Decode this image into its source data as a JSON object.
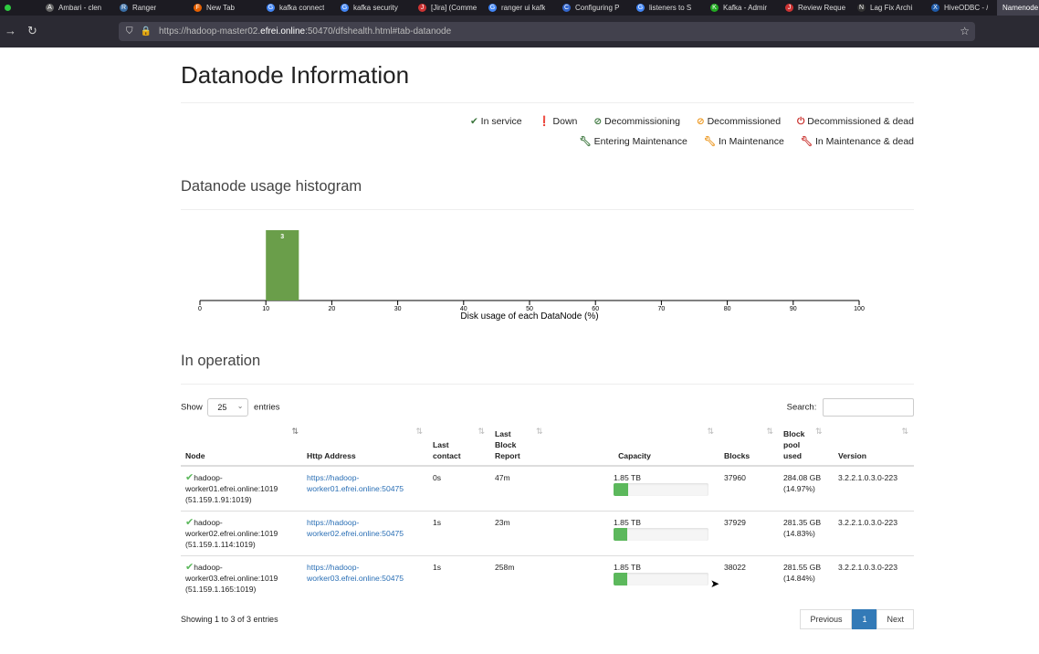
{
  "browser": {
    "tabs": [
      {
        "label": "Ambari - clen",
        "icon": "A"
      },
      {
        "label": "Ranger",
        "icon": "R"
      },
      {
        "label": "New Tab",
        "icon": "F"
      },
      {
        "label": "kafka connect",
        "icon": "G"
      },
      {
        "label": "kafka security",
        "icon": "G"
      },
      {
        "label": "[Jira] (Comme",
        "icon": "J"
      },
      {
        "label": "ranger ui kafk",
        "icon": "G"
      },
      {
        "label": "Configuring P",
        "icon": "C"
      },
      {
        "label": "listeners to S",
        "icon": "G"
      },
      {
        "label": "Kafka - Admir",
        "icon": "K"
      },
      {
        "label": "Review Reque",
        "icon": "J"
      },
      {
        "label": "Lag Fix Archi",
        "icon": "N"
      },
      {
        "label": "HiveODBC - /",
        "icon": "X"
      },
      {
        "label": "Namenode",
        "icon": ""
      }
    ],
    "url_prefix": "https://hadoop-master02.",
    "url_domain": "efrei.online",
    "url_suffix": ":50470/dfshealth.html#tab-datanode"
  },
  "page": {
    "title": "Datanode Information",
    "legend": {
      "in_service": "In service",
      "down": "Down",
      "decommissioning": "Decommissioning",
      "decommissioned": "Decommissioned",
      "decommissioned_dead": "Decommissioned & dead",
      "entering_maintenance": "Entering Maintenance",
      "in_maintenance": "In Maintenance",
      "in_maintenance_dead": "In Maintenance & dead"
    },
    "histogram_title": "Datanode usage histogram",
    "operation_title": "In operation"
  },
  "chart_data": {
    "type": "bar",
    "bins": [
      {
        "start": 10,
        "end": 15,
        "count": 3
      }
    ],
    "bar_label": "3",
    "xlim": [
      0,
      100
    ],
    "xticks": [
      "0",
      "10",
      "20",
      "30",
      "40",
      "50",
      "60",
      "70",
      "80",
      "90",
      "100"
    ],
    "xlabel": "Disk usage of each DataNode (%)",
    "bar_color": "#6a9e4a"
  },
  "table": {
    "show_label": "Show",
    "entries_label": "entries",
    "page_size": "25",
    "search_label": "Search:",
    "headers": {
      "node": "Node",
      "http": "Http Address",
      "last_contact": [
        "Last",
        "contact"
      ],
      "last_block_report": [
        "Last",
        "Block",
        "Report"
      ],
      "capacity": "Capacity",
      "blocks": "Blocks",
      "block_pool_used": [
        "Block",
        "pool",
        "used"
      ],
      "version": "Version"
    },
    "rows": [
      {
        "node1": "hadoop-",
        "node2": "worker01.efrei.online:1019",
        "node3": "(51.159.1.91:1019)",
        "http1": "https://hadoop-",
        "http2": "worker01.efrei.online:50475",
        "last_contact": "0s",
        "last_block": "47m",
        "capacity": "1.85 TB",
        "usage": 0.15,
        "blocks": "37960",
        "pool1": "284.08 GB",
        "pool2": "(14.97%)",
        "version": "3.2.2.1.0.3.0-223"
      },
      {
        "node1": "hadoop-",
        "node2": "worker02.efrei.online:1019",
        "node3": "(51.159.1.114:1019)",
        "http1": "https://hadoop-",
        "http2": "worker02.efrei.online:50475",
        "last_contact": "1s",
        "last_block": "23m",
        "capacity": "1.85 TB",
        "usage": 0.148,
        "blocks": "37929",
        "pool1": "281.35 GB",
        "pool2": "(14.83%)",
        "version": "3.2.2.1.0.3.0-223"
      },
      {
        "node1": "hadoop-",
        "node2": "worker03.efrei.online:1019",
        "node3": "(51.159.1.165:1019)",
        "http1": "https://hadoop-",
        "http2": "worker03.efrei.online:50475",
        "last_contact": "1s",
        "last_block": "258m",
        "capacity": "1.85 TB",
        "usage": 0.148,
        "blocks": "38022",
        "pool1": "281.55 GB",
        "pool2": "(14.84%)",
        "version": "3.2.2.1.0.3.0-223"
      }
    ],
    "footer": "Showing 1 to 3 of 3 entries",
    "pager": {
      "prev": "Previous",
      "current": "1",
      "next": "Next"
    }
  }
}
